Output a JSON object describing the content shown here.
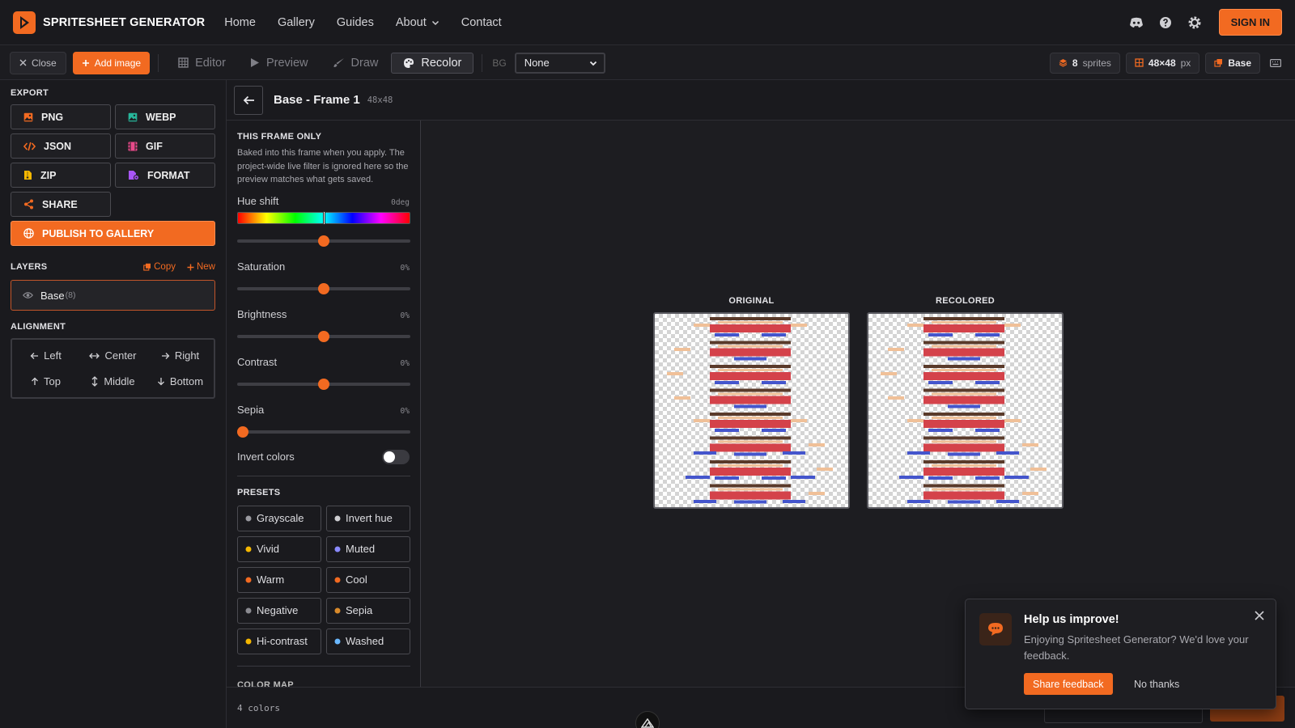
{
  "app": {
    "brand": "SPRITESHEET GENERATOR"
  },
  "nav": {
    "links": [
      "Home",
      "Gallery",
      "Guides",
      "About",
      "Contact"
    ],
    "signin": "SIGN IN"
  },
  "toolbar": {
    "close": "Close",
    "add_image": "Add image",
    "modes": [
      "Editor",
      "Preview",
      "Draw",
      "Recolor"
    ],
    "active_mode": "Recolor",
    "bg_label": "BG",
    "bg_value": "None",
    "sprites_count": "8",
    "sprites_label": "sprites",
    "size_value": "48×48",
    "size_unit": "px",
    "layer": "Base"
  },
  "export": {
    "heading": "EXPORT",
    "buttons": [
      "PNG",
      "WEBP",
      "JSON",
      "GIF",
      "ZIP",
      "FORMAT",
      "SHARE"
    ],
    "publish": "PUBLISH TO GALLERY"
  },
  "layers": {
    "heading": "LAYERS",
    "copy": "Copy",
    "new": "New",
    "items": [
      {
        "name": "Base",
        "count": "(8)"
      }
    ]
  },
  "alignment": {
    "heading": "ALIGNMENT",
    "buttons": [
      "Left",
      "Center",
      "Right",
      "Top",
      "Middle",
      "Bottom"
    ]
  },
  "frame": {
    "title": "Base - Frame 1",
    "size": "48x48"
  },
  "recolor": {
    "heading": "THIS FRAME ONLY",
    "description": "Baked into this frame when you apply. The project-wide live filter is ignored here so the preview matches what gets saved.",
    "hue": {
      "label": "Hue shift",
      "value": "0deg",
      "level": 0.5
    },
    "sliders": [
      {
        "label": "Saturation",
        "value": "0%",
        "level": 0.5
      },
      {
        "label": "Brightness",
        "value": "0%",
        "level": 0.5
      },
      {
        "label": "Contrast",
        "value": "0%",
        "level": 0.5
      },
      {
        "label": "Sepia",
        "value": "0%",
        "level": 0.0
      }
    ],
    "invert_label": "Invert colors",
    "invert_on": false,
    "presets_heading": "PRESETS",
    "presets": [
      {
        "label": "Grayscale",
        "icon": "circle-icon",
        "color": "#9a9aa0"
      },
      {
        "label": "Invert hue",
        "icon": "refresh-icon",
        "color": "#cfcfd3"
      },
      {
        "label": "Vivid",
        "icon": "sun-icon",
        "color": "#f5b700"
      },
      {
        "label": "Muted",
        "icon": "moon-icon",
        "color": "#8a8aff"
      },
      {
        "label": "Warm",
        "icon": "flame-icon",
        "color": "#f26a21"
      },
      {
        "label": "Cool",
        "icon": "snowflake-icon",
        "color": "#f26a21"
      },
      {
        "label": "Negative",
        "icon": "half-circle-icon",
        "color": "#8a8a90"
      },
      {
        "label": "Sepia",
        "icon": "film-icon",
        "color": "#d98a2b"
      },
      {
        "label": "Hi-contrast",
        "icon": "bolt-icon",
        "color": "#f5b700"
      },
      {
        "label": "Washed",
        "icon": "droplet-icon",
        "color": "#6ab8ff"
      }
    ],
    "color_map_heading": "COLOR MAP"
  },
  "preview": {
    "original": "ORIGINAL",
    "recolored": "RECOLORED"
  },
  "bottom": {
    "colors": "4 colors"
  },
  "toast": {
    "title": "Help us improve!",
    "body": "Enjoying Spritesheet Generator? We'd love your feedback.",
    "share": "Share feedback",
    "dismiss": "No thanks"
  },
  "colors": {
    "accent": "#f26a21",
    "sprite_brown": "#5a3a2a",
    "sprite_red": "#d4424a",
    "sprite_blue": "#4455cc",
    "sprite_peach": "#f0c098"
  }
}
